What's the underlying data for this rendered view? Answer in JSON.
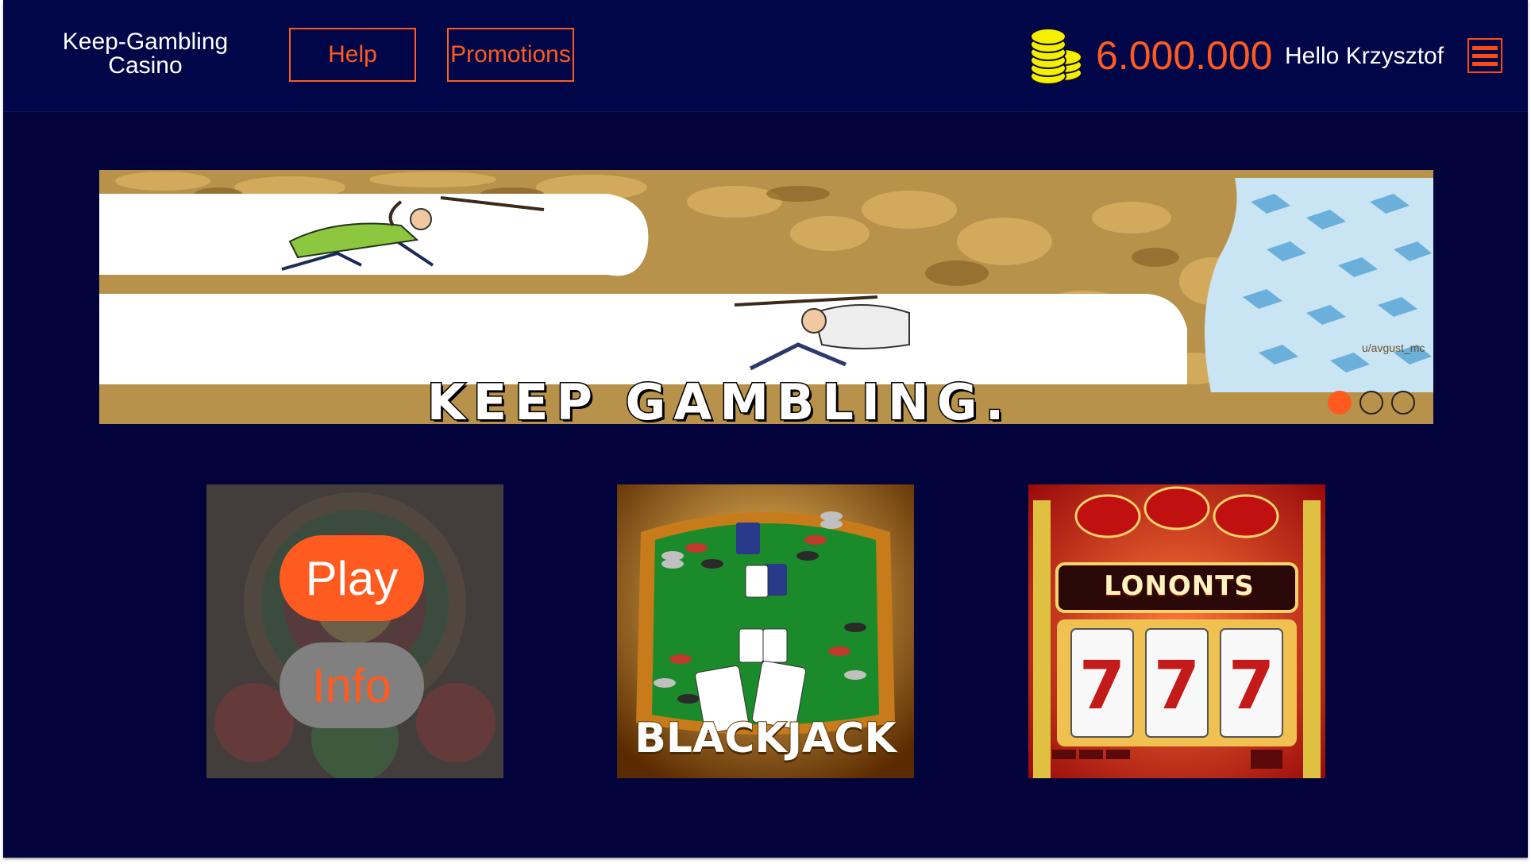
{
  "header": {
    "brand_line1": "Keep-Gambling",
    "brand_line2": "Casino",
    "help_label": "Help",
    "promotions_label": "Promotions",
    "balance": "6.000.000",
    "greeting": "Hello Krzysztof",
    "coin_icon": "coins-icon",
    "menu_icon": "hamburger-menu-icon"
  },
  "banner": {
    "caption": "KEEP GAMBLING.",
    "watermark": "u/avgust_mc",
    "slides": [
      {
        "active": true
      },
      {
        "active": false
      },
      {
        "active": false
      }
    ]
  },
  "games": [
    {
      "name": "Roulette",
      "play_label": "Play",
      "info_label": "Info"
    },
    {
      "name": "Blackjack",
      "title": "BLACKJACK"
    },
    {
      "name": "Slots",
      "title": "LONONTS"
    }
  ],
  "colors": {
    "accent": "#ff5a1f",
    "header_bg": "#010649",
    "page_bg": "#02033a",
    "coin": "#f4f000"
  }
}
